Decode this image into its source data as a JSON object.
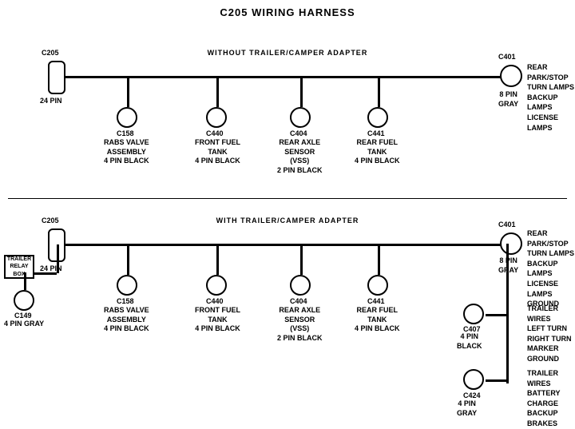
{
  "title": "C205 WIRING HARNESS",
  "top_section": {
    "label": "WITHOUT  TRAILER/CAMPER  ADAPTER",
    "left_connector": {
      "id": "C205",
      "sub": "24 PIN"
    },
    "right_connector": {
      "id": "C401",
      "sub": "8 PIN\nGRAY",
      "labels": [
        "REAR PARK/STOP",
        "TURN LAMPS",
        "BACKUP LAMPS",
        "LICENSE LAMPS"
      ]
    },
    "connectors": [
      {
        "id": "C158",
        "desc": "RABS VALVE\nASSEMBLY\n4 PIN BLACK"
      },
      {
        "id": "C440",
        "desc": "FRONT FUEL\nTANK\n4 PIN BLACK"
      },
      {
        "id": "C404",
        "desc": "REAR AXLE\nSENSOR\n(VSS)\n2 PIN BLACK"
      },
      {
        "id": "C441",
        "desc": "REAR FUEL\nTANK\n4 PIN BLACK"
      }
    ]
  },
  "bottom_section": {
    "label": "WITH  TRAILER/CAMPER  ADAPTER",
    "left_connector": {
      "id": "C205",
      "sub": "24 PIN"
    },
    "right_connector": {
      "id": "C401",
      "sub": "8 PIN\nGRAY",
      "labels": [
        "REAR PARK/STOP",
        "TURN LAMPS",
        "BACKUP LAMPS",
        "LICENSE LAMPS",
        "GROUND"
      ]
    },
    "extra_left": {
      "box": "TRAILER\nRELAY\nBOX",
      "conn": {
        "id": "C149",
        "desc": "4 PIN GRAY"
      }
    },
    "connectors": [
      {
        "id": "C158",
        "desc": "RABS VALVE\nASSEMBLY\n4 PIN BLACK"
      },
      {
        "id": "C440",
        "desc": "FRONT FUEL\nTANK\n4 PIN BLACK"
      },
      {
        "id": "C404",
        "desc": "REAR AXLE\nSENSOR\n(VSS)\n2 PIN BLACK"
      },
      {
        "id": "C441",
        "desc": "REAR FUEL\nTANK\n4 PIN BLACK"
      }
    ],
    "right_extras": [
      {
        "id": "C407",
        "desc": "4 PIN\nBLACK",
        "labels": [
          "TRAILER WIRES",
          "LEFT TURN",
          "RIGHT TURN",
          "MARKER",
          "GROUND"
        ]
      },
      {
        "id": "C424",
        "desc": "4 PIN\nGRAY",
        "labels": [
          "TRAILER WIRES",
          "BATTERY CHARGE",
          "BACKUP",
          "BRAKES"
        ]
      }
    ]
  }
}
